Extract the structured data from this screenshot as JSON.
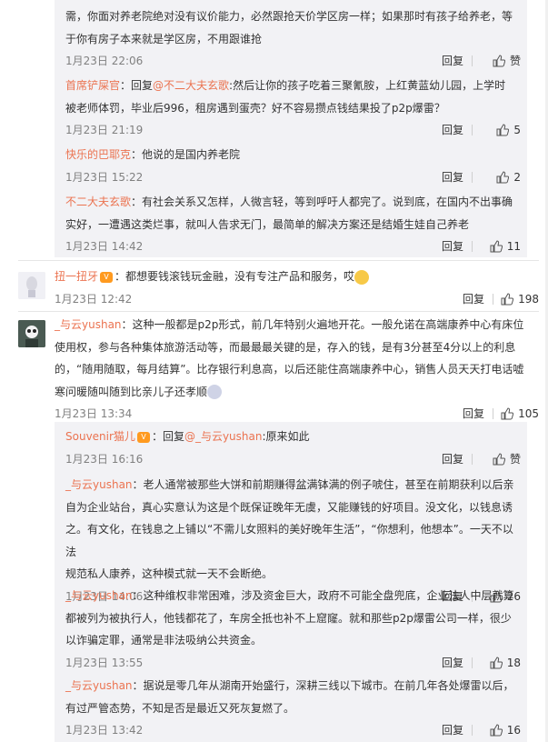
{
  "c1": {
    "line1": "需，你面对养老院绝对没有议价能力，必然跟抢天价学区房一样；如果那时有孩子给养老，等",
    "line2": "于你有房子本来就是学区房，不用跟谁抢",
    "time": "1月23日 22:06",
    "reply": "回复",
    "likes": "赞"
  },
  "c2": {
    "user": "首席铲屎官",
    "prefix": "：回复",
    "mention": "@不二大夫玄歌",
    "line1": ":然后让你的孩子吃着三聚氰胺，上红黄蓝幼儿园，上学时",
    "line2": "被老师体罚，毕业后996，租房遇到蛋壳？好不容易攒点钱结果投了p2p爆雷？",
    "time": "1月23日 21:19",
    "reply": "回复",
    "likes": "5"
  },
  "c3": {
    "user": "快乐的巴耶克",
    "text": "：他说的是国内养老院",
    "time": "1月23日 15:22",
    "reply": "回复",
    "likes": "2"
  },
  "c4": {
    "user": "不二大夫玄歌",
    "line1": "：有社会关系又怎样，人微言轻，等到呼吁人都完了。说到底，在国内不出事确",
    "line2": "实好，一遭遇这类烂事，就叫人告求无门，最简单的解决方案还是结婚生娃自己养老",
    "time": "1月23日 14:42",
    "reply": "回复",
    "likes": "11"
  },
  "c5": {
    "user": "扭一扭牙",
    "text": "：都想要钱滚钱玩金融，没有专注产品和服务，哎",
    "time": "1月23日 12:42",
    "reply": "回复",
    "likes": "198"
  },
  "c6": {
    "user": "_与云yushan",
    "line1": "：这种一般都是p2p形式，前几年特别火遍地开花。一般允诺在高端康养中心有床位",
    "line2": "使用权，参与各种集体旅游活动等，而最最最关键的是，存入的钱，是有3分甚至4分以上的利息",
    "line3": "的，“随用随取，每月结算”。比存银行利息高，以后还能住高端康养中心，销售人员天天打电话嘘",
    "line4": "寒问暖随叫随到比亲儿子还孝顺",
    "time": "1月23日 13:34",
    "reply": "回复",
    "likes": "105"
  },
  "c7": {
    "user": "Souvenir猫儿",
    "prefix": "：回复",
    "mention": "@_与云yushan",
    "text": ":原来如此",
    "time": "1月23日 16:16",
    "reply": "回复",
    "likes": "赞"
  },
  "c8": {
    "user": "_与云yushan",
    "line1": "：老人通常被那些大饼和前期赚得盆满钵满的例子唬住，甚至在前期获利以后亲",
    "line2": "自为企业站台，真心实意认为这是个既保证晚年无虞，又能赚钱的好项目。没文化，以钱息诱",
    "line3": "之。有文化，在钱息之上铺以“不需儿女照料的美好晚年生活”，“你想利，他想本”。一天不以法",
    "line4": "规范私人康养，这种模式就一天不会断绝。",
    "time": "1月23日 14:06",
    "reply": "回复",
    "likes": "26"
  },
  "c9": {
    "user": "_与云yushan",
    "line1": "：这种维权非常困难，涉及资金巨大，政府不可能全盘兜底，企业法人中层就算",
    "line2": "都被列为被执行人，他钱都花了，车房全抵也补不上窟窿。就和那些p2p爆雷公司一样，很少",
    "line3": "以诈骗定罪，通常是非法吸纳公共资金。",
    "time": "1月23日 13:55",
    "reply": "回复",
    "likes": "18"
  },
  "c10": {
    "user": "_与云yushan",
    "line1": "：据说是零几年从湖南开始盛行，深耕三线以下城市。在前几年各处爆雷以后，",
    "line2": "有过严管态势，不知是否是最近又死灰复燃了。",
    "time": "1月23日 13:42",
    "reply": "回复",
    "likes": "16"
  },
  "icons": {
    "like": "thumbs-up-icon",
    "vip": "vip-badge-icon",
    "emoji": "emoji-icon"
  },
  "colors": {
    "username": "#eb7350",
    "time": "#808080",
    "panel": "#f2f2f5"
  }
}
